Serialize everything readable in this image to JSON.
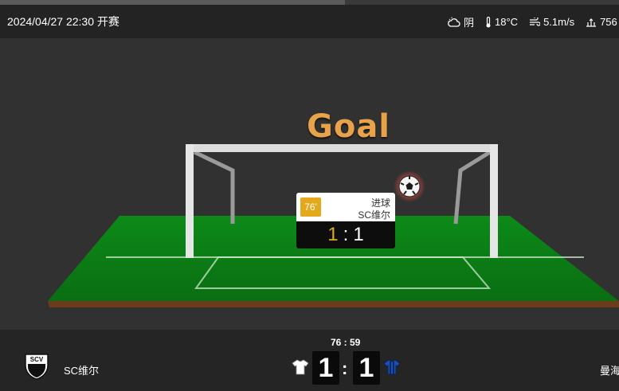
{
  "header": {
    "kickoff": "2024/04/27 22:30 开赛",
    "weather": [
      {
        "icon": "cloudy-icon",
        "text": "阴"
      },
      {
        "icon": "thermometer-icon",
        "text": "18°C"
      },
      {
        "icon": "wind-icon",
        "text": "5.1m/s"
      },
      {
        "icon": "pressure-icon",
        "text": "756"
      }
    ]
  },
  "animation": {
    "title": "Goal",
    "event": {
      "minute": "76'",
      "type": "进球",
      "team": "SC维尔",
      "score_home": "1",
      "separator": ":",
      "score_away": "1"
    }
  },
  "scoreboard": {
    "home_team": "SC维尔",
    "home_logo_text": "SCV",
    "away_team": "曼海",
    "clock": "76 : 59",
    "home_score": "1",
    "away_score": "1",
    "separator": ":",
    "home_jersey_color": "#ffffff",
    "away_jersey_color": "#1a4fb8"
  }
}
